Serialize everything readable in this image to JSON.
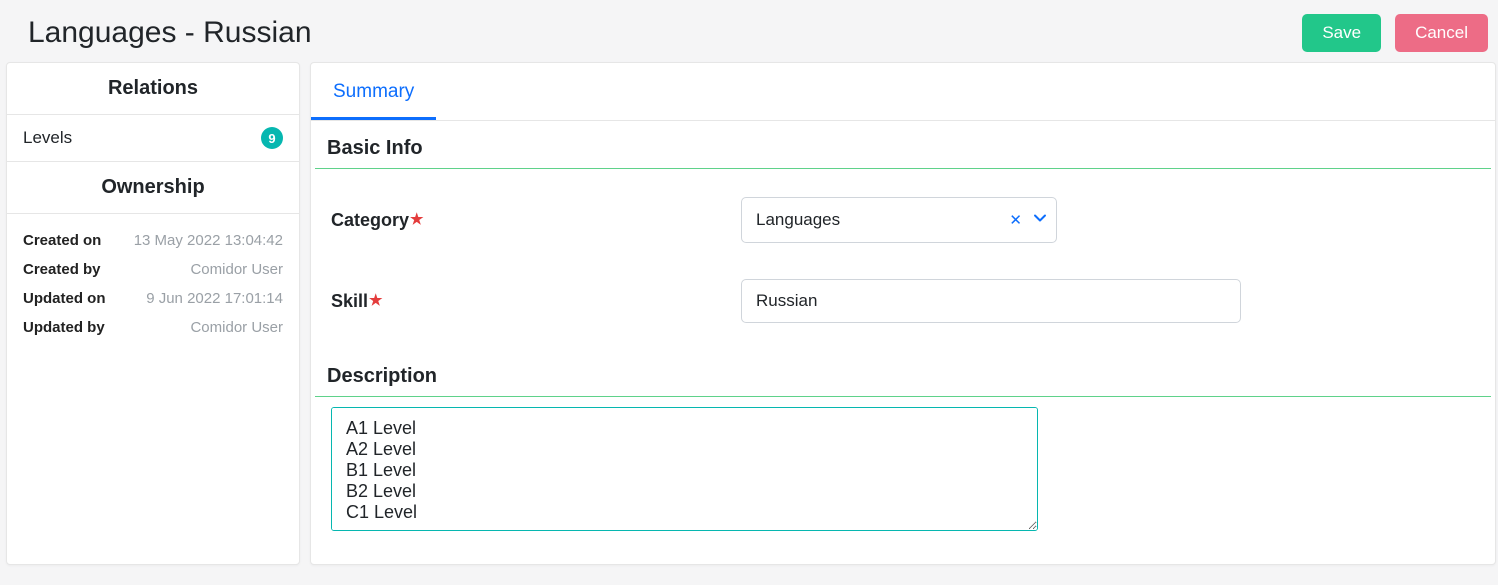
{
  "header": {
    "title": "Languages - Russian",
    "save_label": "Save",
    "cancel_label": "Cancel"
  },
  "sidebar": {
    "relations_title": "Relations",
    "relations_items": [
      {
        "label": "Levels",
        "count": "9"
      }
    ],
    "ownership_title": "Ownership",
    "ownership": {
      "created_on_label": "Created on",
      "created_on_value": "13 May 2022 13:04:42",
      "created_by_label": "Created by",
      "created_by_value": "Comidor User",
      "updated_on_label": "Updated on",
      "updated_on_value": "9 Jun 2022 17:01:14",
      "updated_by_label": "Updated by",
      "updated_by_value": "Comidor User"
    }
  },
  "tabs": {
    "summary_label": "Summary"
  },
  "basic_info": {
    "section_title": "Basic Info",
    "category_label": "Category",
    "category_value": "Languages",
    "skill_label": "Skill",
    "skill_value": "Russian"
  },
  "description": {
    "section_title": "Description",
    "value": "A1 Level\nA2 Level\nB1 Level\nB2 Level\nC1 Level"
  }
}
